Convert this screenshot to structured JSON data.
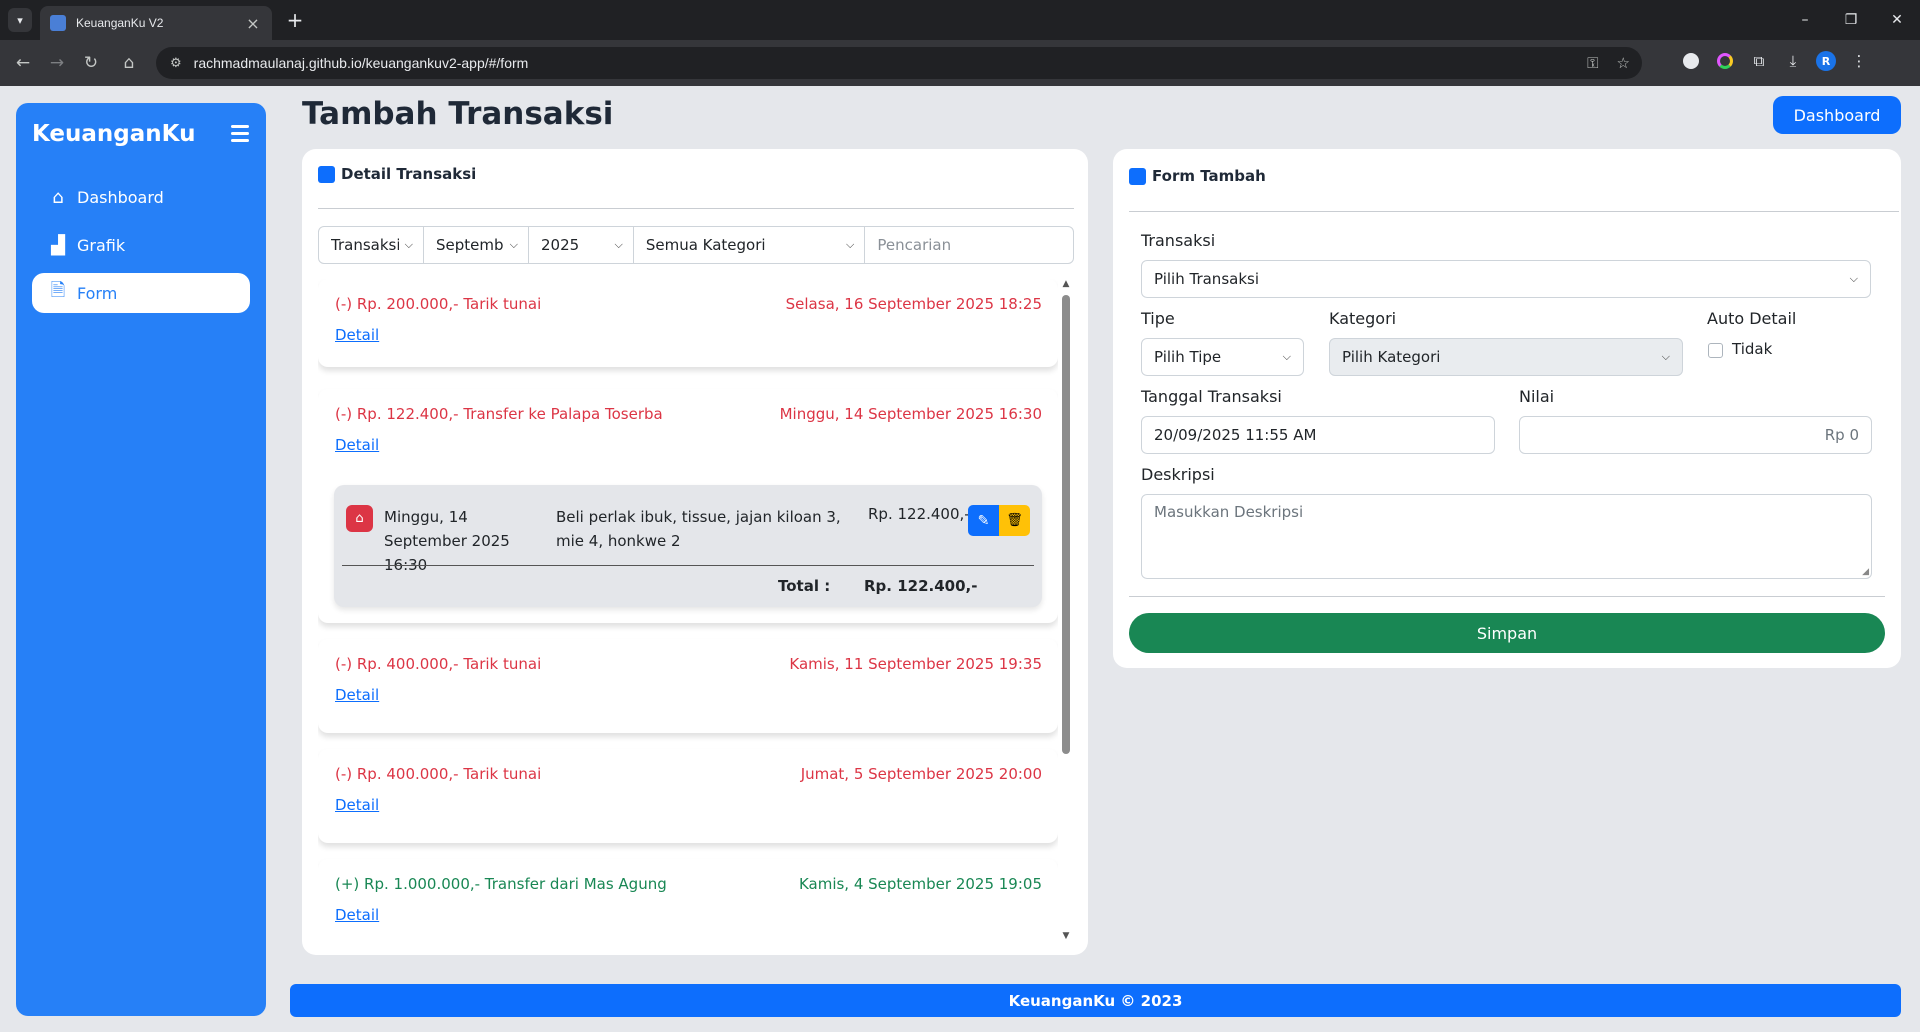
{
  "browser": {
    "tab_title": "KeuanganKu V2",
    "url": "rachmadmaulanaj.github.io/keuangankuv2-app/#/form",
    "profile_initial": "R"
  },
  "sidebar": {
    "brand": "KeuanganKu",
    "items": [
      {
        "label": "Dashboard",
        "icon": "house-icon"
      },
      {
        "label": "Grafik",
        "icon": "chart-icon"
      },
      {
        "label": "Form",
        "icon": "file-icon"
      }
    ]
  },
  "header": {
    "title": "Tambah Transaksi",
    "dashboard_button": "Dashboard"
  },
  "detail": {
    "title": "Detail Transaksi",
    "filters": {
      "transaksi": "Transaksi",
      "bulan": "September",
      "tahun": "2025",
      "kategori": "Semua Kategori",
      "search_placeholder": "Pencarian"
    },
    "transactions": [
      {
        "amount_text": "(-) Rp. 200.000,- Tarik tunai",
        "date": "Selasa, 16 September 2025 18:25",
        "detail_link": "Detail",
        "type": "out"
      },
      {
        "amount_text": "(-) Rp. 122.400,- Transfer ke Palapa Toserba",
        "date": "Minggu, 14 September 2025 16:30",
        "detail_link": "Detail",
        "type": "out",
        "sub": {
          "date": "Minggu, 14 September 2025 16:30",
          "description": "Beli perlak ibuk, tissue, jajan kiloan 3, mie 4, honkwe 2",
          "amount": "Rp. 122.400,-",
          "total_label": "Total :",
          "total_value": "Rp. 122.400,-"
        }
      },
      {
        "amount_text": "(-) Rp. 400.000,- Tarik tunai",
        "date": "Kamis, 11 September 2025 19:35",
        "detail_link": "Detail",
        "type": "out"
      },
      {
        "amount_text": "(-) Rp. 400.000,- Tarik tunai",
        "date": "Jumat, 5 September 2025 20:00",
        "detail_link": "Detail",
        "type": "out"
      },
      {
        "amount_text": "(+) Rp. 1.000.000,- Transfer dari Mas Agung",
        "date": "Kamis, 4 September 2025 19:05",
        "detail_link": "Detail",
        "type": "in"
      }
    ]
  },
  "form": {
    "title": "Form Tambah",
    "transaksi_label": "Transaksi",
    "transaksi_value": "Pilih Transaksi",
    "tipe_label": "Tipe",
    "tipe_value": "Pilih Tipe",
    "kategori_label": "Kategori",
    "kategori_value": "Pilih Kategori",
    "auto_detail_label": "Auto Detail",
    "auto_detail_option": "Tidak",
    "tanggal_label": "Tanggal Transaksi",
    "tanggal_value": "20/09/2025 11:55 AM",
    "nilai_label": "Nilai",
    "nilai_placeholder": "Rp 0",
    "deskripsi_label": "Deskripsi",
    "deskripsi_placeholder": "Masukkan Deskripsi",
    "save_button": "Simpan"
  },
  "footer": {
    "text": "KeuanganKu © 2023"
  },
  "colors": {
    "primary": "#0d6efd",
    "sidebar": "#2680f7",
    "expense": "#dc3545",
    "income": "#198754",
    "save": "#198754"
  }
}
